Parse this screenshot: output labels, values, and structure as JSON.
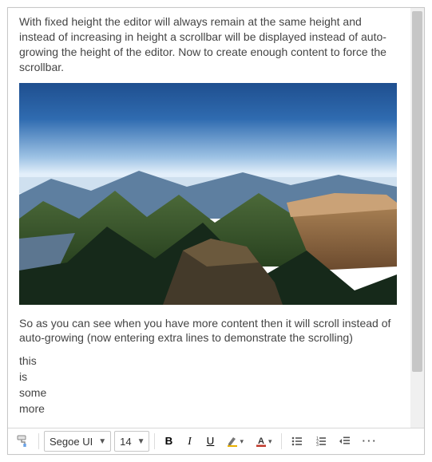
{
  "content": {
    "paragraph1": "With fixed height the editor will always remain at the same height and instead of increasing in height a scrollbar will be displayed instead of auto-growing the height of the editor. Now to create enough content to force the scrollbar.",
    "paragraph2": "So as you can see when you have more content then it will scroll instead of auto-growing (now entering extra lines to demonstrate the scrolling)",
    "line1": "this",
    "line2": "is",
    "line3": "some",
    "line4": "more",
    "image_alt": "landscape-photo"
  },
  "toolbar": {
    "clean_tooltip": "Clear formatting",
    "font_family": "Segoe UI",
    "font_size": "14",
    "bold": "B",
    "italic": "I",
    "underline": "U",
    "highlight_color": "#e8b000",
    "font_color": "#c0392b",
    "more": "···"
  }
}
